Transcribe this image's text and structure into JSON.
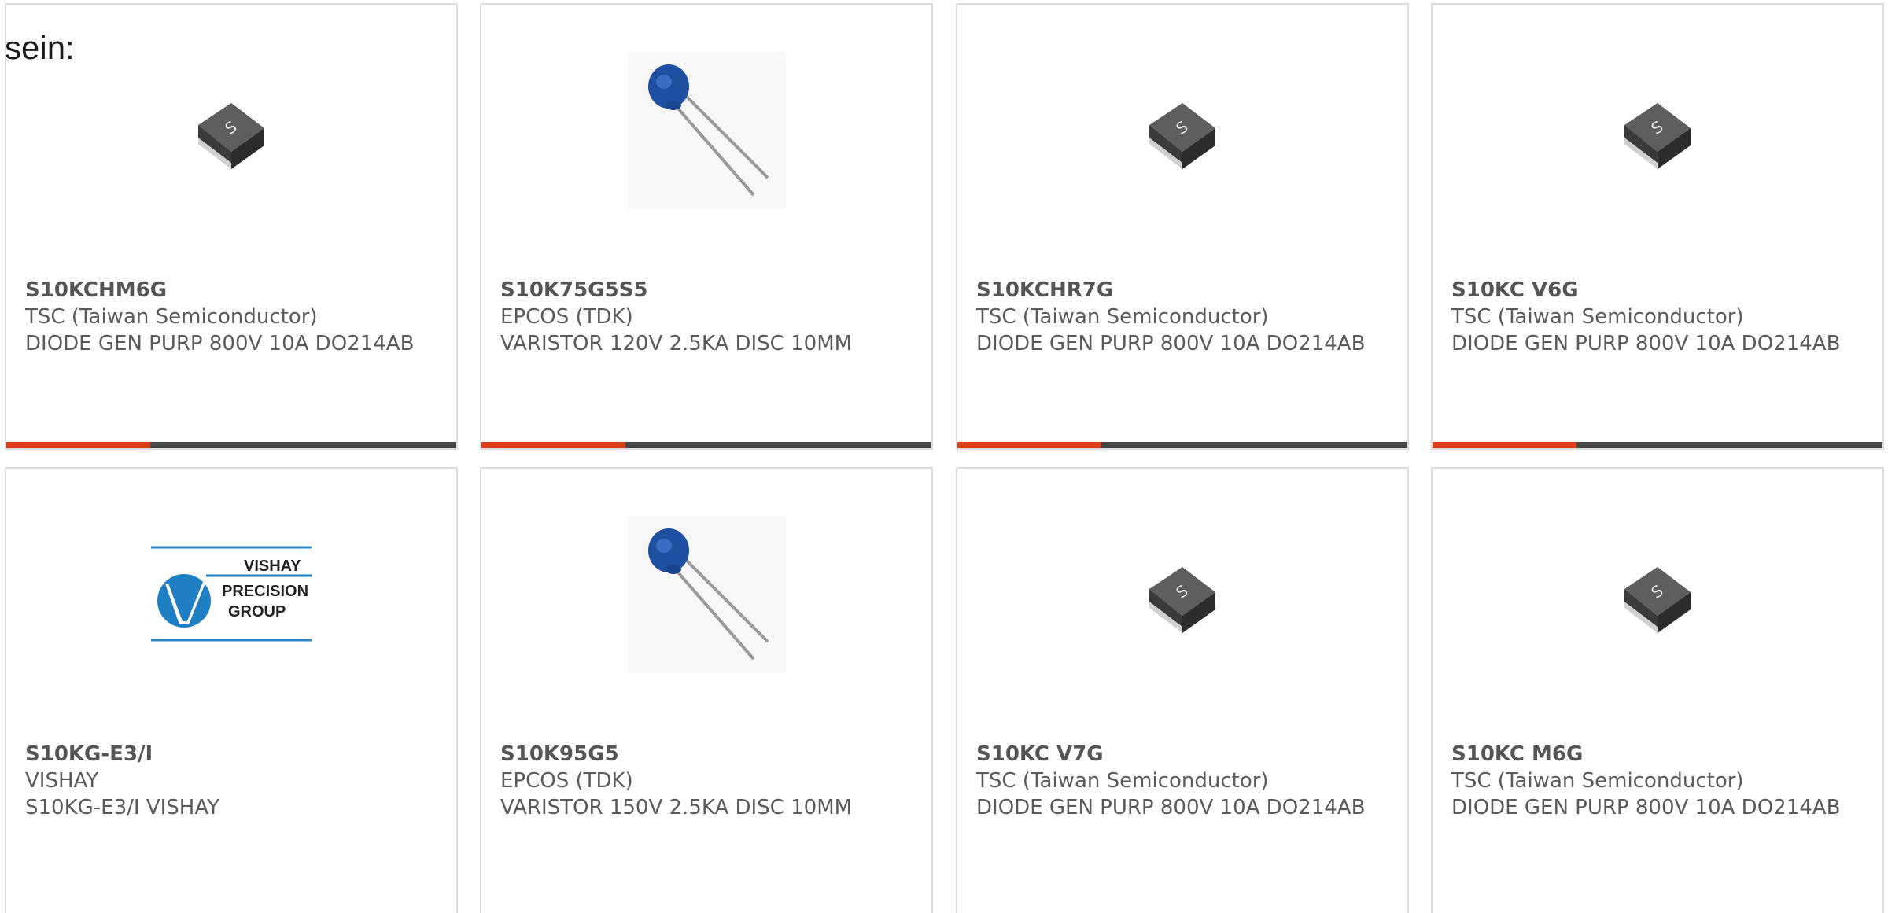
{
  "intro_text": "sein:",
  "colors": {
    "accent": "#e03e17",
    "bar": "#464646",
    "border": "#dcdcdc",
    "text": "#5a5a5a"
  },
  "products": [
    {
      "part_number": "S10KCHM6G",
      "manufacturer": "TSC (Taiwan Semiconductor)",
      "description": "DIODE GEN PURP 800V 10A DO214AB",
      "image": "smd-diode-package-icon"
    },
    {
      "part_number": "S10K75G5S5",
      "manufacturer": "EPCOS (TDK)",
      "description": "VARISTOR 120V 2.5KA DISC 10MM",
      "image": "disc-varistor-icon"
    },
    {
      "part_number": "S10KCHR7G",
      "manufacturer": "TSC (Taiwan Semiconductor)",
      "description": "DIODE GEN PURP 800V 10A DO214AB",
      "image": "smd-diode-package-icon"
    },
    {
      "part_number": "S10KC V6G",
      "manufacturer": "TSC (Taiwan Semiconductor)",
      "description": "DIODE GEN PURP 800V 10A DO214AB",
      "image": "smd-diode-package-icon"
    },
    {
      "part_number": "S10KG-E3/I",
      "manufacturer": "VISHAY",
      "description": "S10KG-E3/I VISHAY",
      "image": "vishay-precision-group-logo",
      "logo_lines": [
        "VISHAY",
        "PRECISION",
        "GROUP"
      ]
    },
    {
      "part_number": "S10K95G5",
      "manufacturer": "EPCOS (TDK)",
      "description": "VARISTOR 150V 2.5KA DISC 10MM",
      "image": "disc-varistor-icon"
    },
    {
      "part_number": "S10KC V7G",
      "manufacturer": "TSC (Taiwan Semiconductor)",
      "description": "DIODE GEN PURP 800V 10A DO214AB",
      "image": "smd-diode-package-icon"
    },
    {
      "part_number": "S10KC M6G",
      "manufacturer": "TSC (Taiwan Semiconductor)",
      "description": "DIODE GEN PURP 800V 10A DO214AB",
      "image": "smd-diode-package-icon"
    }
  ]
}
